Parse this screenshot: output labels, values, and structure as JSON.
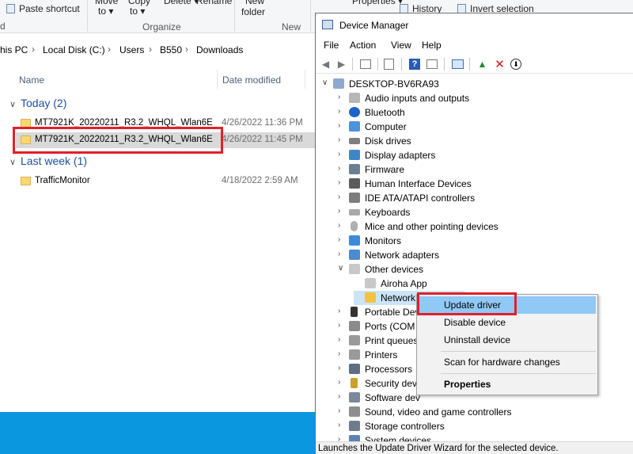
{
  "ribbon": {
    "paste_shortcut": "Paste shortcut",
    "move_to": "Move",
    "move_to2": "to",
    "copy_to": "Copy",
    "copy_to2": "to",
    "delete": "Delete",
    "rename": "Rename",
    "new_folder": "New",
    "new_folder2": "folder",
    "properties": "Properties",
    "history": "History",
    "invert_selection": "Invert selection",
    "group_organize": "Organize",
    "group_new": "New"
  },
  "address": {
    "crumbs": [
      "his PC",
      "Local Disk (C:)",
      "Users",
      "B550",
      "Downloads"
    ]
  },
  "columns": {
    "name": "Name",
    "date_modified": "Date modified"
  },
  "groups": [
    {
      "label": "Today (2)"
    },
    {
      "label": "Last week (1)"
    }
  ],
  "files": [
    {
      "name": "MT7921K_20220211_R3.2_WHQL_Wlan6E",
      "date": "4/26/2022 11:36 PM"
    },
    {
      "name": "MT7921K_20220211_R3.2_WHQL_Wlan6E",
      "date": "4/26/2022 11:45 PM"
    },
    {
      "name": "TrafficMonitor",
      "date": "4/18/2022 2:59 AM"
    }
  ],
  "devmgr": {
    "title": "Device Manager",
    "menu": [
      "File",
      "Action",
      "View",
      "Help"
    ],
    "root": "DESKTOP-BV6RA93",
    "categories": [
      "Audio inputs and outputs",
      "Bluetooth",
      "Computer",
      "Disk drives",
      "Display adapters",
      "Firmware",
      "Human Interface Devices",
      "IDE ATA/ATAPI controllers",
      "Keyboards",
      "Mice and other pointing devices",
      "Monitors",
      "Network adapters",
      "Other devices",
      "Airoha App",
      "Network",
      "Portable Dev",
      "Ports (COM",
      "Print queues",
      "Printers",
      "Processors",
      "Security dev",
      "Software dev",
      "Sound, video and game controllers",
      "Storage controllers",
      "System devices"
    ],
    "status": "Launches the Update Driver Wizard for the selected device."
  },
  "context_menu": {
    "update_driver": "Update driver",
    "disable_device": "Disable device",
    "uninstall_device": "Uninstall device",
    "scan": "Scan for hardware changes",
    "properties": "Properties"
  },
  "colors": {
    "accent_red": "#e0202a",
    "taskbar": "#0b97e0",
    "menu_highlight": "#90c8f6"
  }
}
